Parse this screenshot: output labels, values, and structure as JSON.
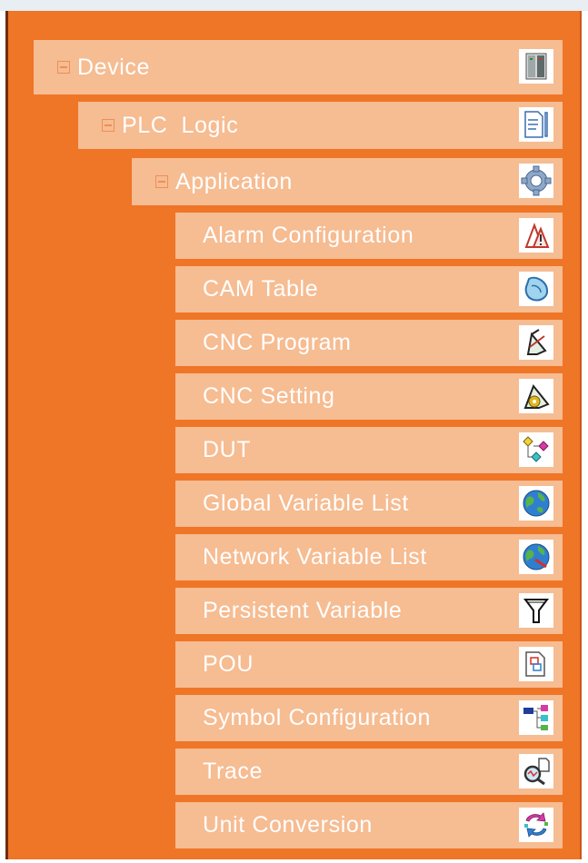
{
  "tree": {
    "device": {
      "label": "Device",
      "icon": "device-cabinet-icon"
    },
    "plc_logic": {
      "label": "PLC  Logic",
      "icon": "plc-logic-document-icon"
    },
    "application": {
      "label": "Application",
      "icon": "application-gear-icon"
    },
    "children": [
      {
        "label": "Alarm Configuration",
        "icon": "alarm-warning-icon"
      },
      {
        "label": "CAM Table",
        "icon": "cam-table-icon"
      },
      {
        "label": "CNC Program",
        "icon": "cnc-program-icon"
      },
      {
        "label": "CNC Setting",
        "icon": "cnc-setting-icon"
      },
      {
        "label": "DUT",
        "icon": "dut-data-type-icon"
      },
      {
        "label": "Global Variable List",
        "icon": "global-variable-globe-icon"
      },
      {
        "label": "Network Variable List",
        "icon": "network-variable-globe-icon"
      },
      {
        "label": "Persistent Variable",
        "icon": "persistent-funnel-icon"
      },
      {
        "label": "POU",
        "icon": "pou-icon"
      },
      {
        "label": "Symbol Configuration",
        "icon": "symbol-configuration-icon"
      },
      {
        "label": "Trace",
        "icon": "trace-magnifier-icon"
      },
      {
        "label": "Unit Conversion",
        "icon": "unit-conversion-icon"
      }
    ]
  },
  "colors": {
    "panel_background": "#ef7527",
    "node_background": "#f6bc92",
    "label_text": "#ffffff"
  }
}
